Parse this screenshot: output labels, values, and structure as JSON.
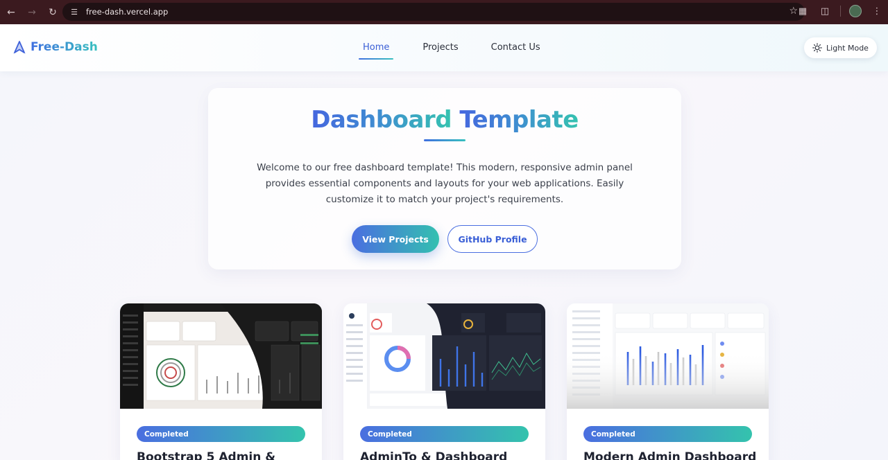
{
  "browser": {
    "url": "free-dash.vercel.app"
  },
  "site": {
    "brand": "Free-Dash",
    "nav": [
      "Home",
      "Projects",
      "Contact Us"
    ],
    "mode_label": "Light Mode"
  },
  "hero": {
    "title_part1": "Dashboard",
    "title_part2": "Template",
    "description": "Welcome to our free dashboard template! This modern, responsive admin panel provides essential components and layouts for your web applications. Easily customize it to match your project's requirements.",
    "primary_button": "View Projects",
    "secondary_button": "GitHub Profile"
  },
  "projects": [
    {
      "status": "Completed",
      "title": "Bootstrap 5 Admin &"
    },
    {
      "status": "Completed",
      "title": "AdminTo & Dashboard"
    },
    {
      "status": "Completed",
      "title": "Modern Admin Dashboard"
    }
  ],
  "colors": {
    "brand_start": "#3f6fe0",
    "brand_end": "#38c0bf",
    "chrome_bg": "#3b1a1f"
  }
}
